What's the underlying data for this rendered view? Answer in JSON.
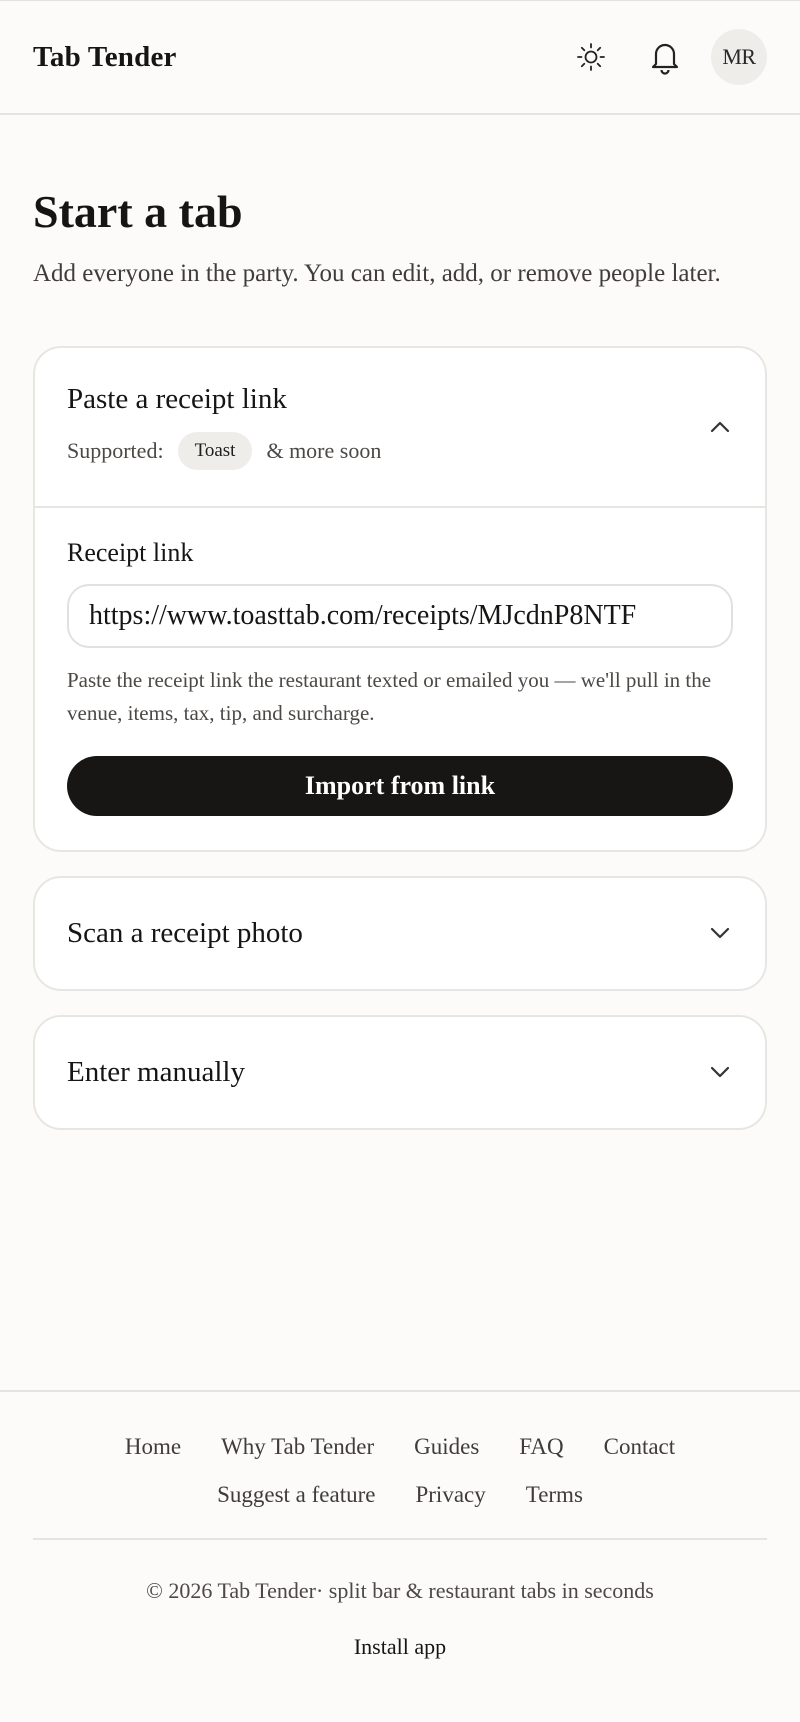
{
  "header": {
    "brand": "Tab Tender",
    "avatar_initials": "MR",
    "theme_icon": "sun-icon",
    "notifications_icon": "bell-icon"
  },
  "main": {
    "title": "Start a tab",
    "subtitle": "Add everyone in the party. You can edit, add, or remove people later.",
    "receipt_link_card": {
      "title": "Paste a receipt link",
      "supported_label": "Supported:",
      "supported_badge": "Toast",
      "more_soon": "& more soon",
      "expanded": true,
      "field_label": "Receipt link",
      "input_value": "https://www.toasttab.com/receipts/MJcdnP8NTF",
      "help_text": "Paste the receipt link the restaurant texted or emailed you — we'll pull in the venue, items, tax, tip, and surcharge.",
      "button_label": "Import from link"
    },
    "scan_card": {
      "title": "Scan a receipt photo",
      "expanded": false
    },
    "manual_card": {
      "title": "Enter manually",
      "expanded": false
    }
  },
  "footer": {
    "links_row1": [
      "Home",
      "Why Tab Tender",
      "Guides",
      "FAQ",
      "Contact"
    ],
    "links_row2": [
      "Suggest a feature",
      "Privacy",
      "Terms"
    ],
    "copyright": "© 2026 Tab Tender· split bar & restaurant tabs in seconds",
    "install_label": "Install app"
  }
}
